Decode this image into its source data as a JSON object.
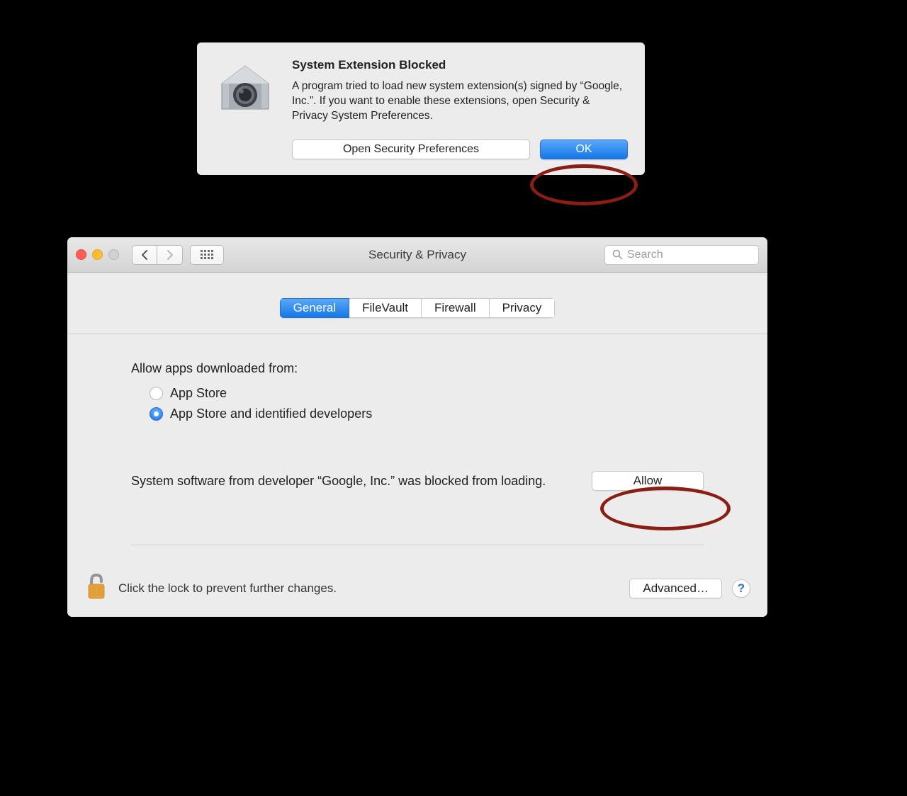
{
  "alert": {
    "title": "System Extension Blocked",
    "body": "A program tried to load new system extension(s) signed by “Google, Inc.”.  If you want to enable these extensions, open Security & Privacy System Preferences.",
    "open_button": "Open Security Preferences",
    "ok_button": "OK"
  },
  "prefs": {
    "window_title": "Security & Privacy",
    "search_placeholder": "Search",
    "tabs": {
      "general": "General",
      "filevault": "FileVault",
      "firewall": "Firewall",
      "privacy": "Privacy"
    },
    "section_label": "Allow apps downloaded from:",
    "radio_app_store": "App Store",
    "radio_identified": "App Store and identified developers",
    "blocked_text": "System software from developer “Google, Inc.” was blocked from loading.",
    "allow_button": "Allow",
    "lock_text": "Click the lock to prevent further changes.",
    "advanced_button": "Advanced…",
    "help_label": "?"
  }
}
